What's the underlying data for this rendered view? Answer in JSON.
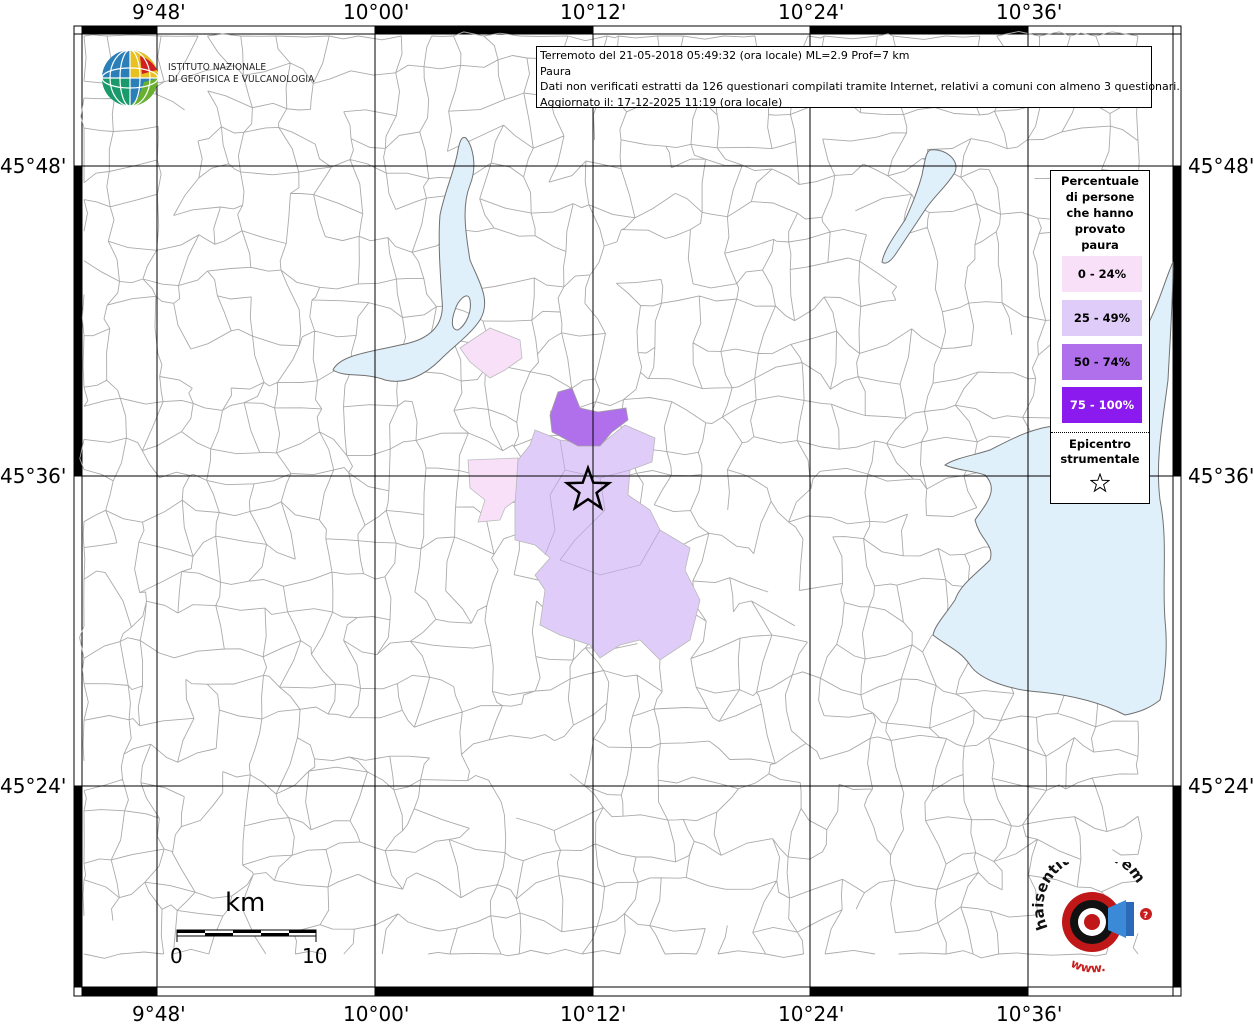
{
  "map": {
    "grid": {
      "top_lon_labels": [
        "9°48'",
        "10°00'",
        "10°12'",
        "10°24'",
        "10°36'"
      ],
      "bottom_lon_labels": [
        "9°48'",
        "10°00'",
        "10°12'",
        "10°24'",
        "10°36'"
      ],
      "left_lat_labels": [
        "45°48'",
        "45°36'",
        "45°24'"
      ],
      "right_lat_labels": [
        "45°48'",
        "45°36'",
        "45°24'"
      ]
    },
    "info_box": {
      "line1": "Terremoto del 21-05-2018 05:49:32 (ora locale) ML=2.9 Prof=7 km",
      "line2": "Paura",
      "line3": "Dati non verificati estratti da 126 questionari compilati tramite Internet, relativi a comuni con almeno 3 questionari.",
      "line4": "Aggiornato il: 17-12-2025 11:19 (ora locale)"
    },
    "logo_ingv": {
      "line1": "ISTITUTO NAZIONALE",
      "line2": "DI GEOFISICA E VULCANOLOGIA"
    },
    "legend": {
      "title_lines": [
        "Percentuale",
        "di persone",
        "che hanno",
        "provato",
        "paura"
      ],
      "classes": [
        {
          "label": "0 - 24%",
          "color": "#f8e0f8",
          "text_color": "#000000"
        },
        {
          "label": "25 - 49%",
          "color": "#e0ccf8",
          "text_color": "#000000"
        },
        {
          "label": "50 - 74%",
          "color": "#b070ec",
          "text_color": "#000000"
        },
        {
          "label": "75 - 100%",
          "color": "#8a1aee",
          "text_color": "#ffffff"
        }
      ],
      "epicenter_lines": [
        "Epicentro",
        "strumentale"
      ],
      "epicenter_symbol": "star-icon"
    },
    "scale": {
      "unit": "km",
      "start": "0",
      "end": "10"
    },
    "hst_logo": {
      "text": "haisentitoilterremoto.it",
      "www": "www."
    },
    "colors": {
      "water": "#dff0fa",
      "water_border": "#707070",
      "boundary": "#a8a8a8",
      "grid": "#000000"
    }
  }
}
